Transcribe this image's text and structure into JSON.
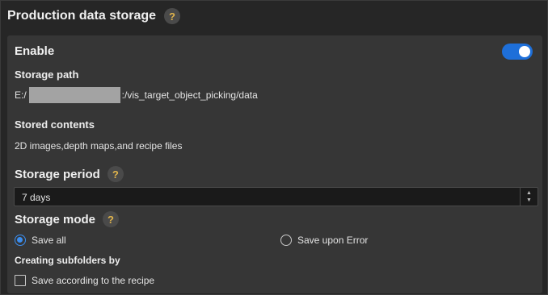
{
  "header": {
    "title": "Production data storage",
    "help_glyph": "?"
  },
  "enable": {
    "label": "Enable",
    "on": true
  },
  "storage_path": {
    "label": "Storage path",
    "prefix": "E:/",
    "suffix": ":/vis_target_object_picking/data"
  },
  "stored_contents": {
    "label": "Stored contents",
    "value": "2D images,depth maps,and recipe files"
  },
  "storage_period": {
    "label": "Storage period",
    "help_glyph": "?",
    "value": "7 days"
  },
  "storage_mode": {
    "label": "Storage mode",
    "help_glyph": "?",
    "options": [
      {
        "label": "Save all",
        "selected": true
      },
      {
        "label": "Save upon Error",
        "selected": false
      }
    ]
  },
  "subfolders": {
    "label": "Creating subfolders by",
    "checkbox_label": "Save according to the recipe",
    "checked": false
  },
  "colors": {
    "accent": "#1e6fd9",
    "help_icon": "#e0b44c",
    "panel": "#363636",
    "background": "#262626"
  }
}
